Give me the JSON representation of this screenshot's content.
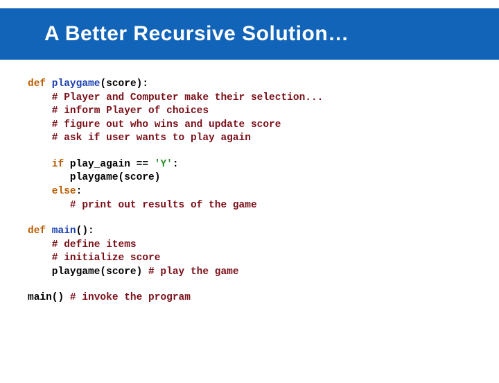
{
  "title": "A Better Recursive Solution…",
  "code": {
    "l1a": "def",
    "l1b": " playgame",
    "l1c": "(score):",
    "l2": "    # Player and Computer make their selection...",
    "l3": "    # inform Player of choices",
    "l4": "    # figure out who wins and update score",
    "l5": "    # ask if user wants to play again",
    "l6a": "    if",
    "l6b": " play_again == ",
    "l6c": "'Y'",
    "l6d": ":",
    "l7": "       playgame(score)",
    "l8a": "    else",
    "l8b": ":",
    "l9": "       # print out results of the game",
    "l10a": "def",
    "l10b": " main",
    "l10c": "():",
    "l11": "    # define items",
    "l12": "    # initialize score",
    "l13a": "    playgame(score) ",
    "l13b": "# play the game",
    "l14a": "main() ",
    "l14b": "# invoke the program"
  }
}
